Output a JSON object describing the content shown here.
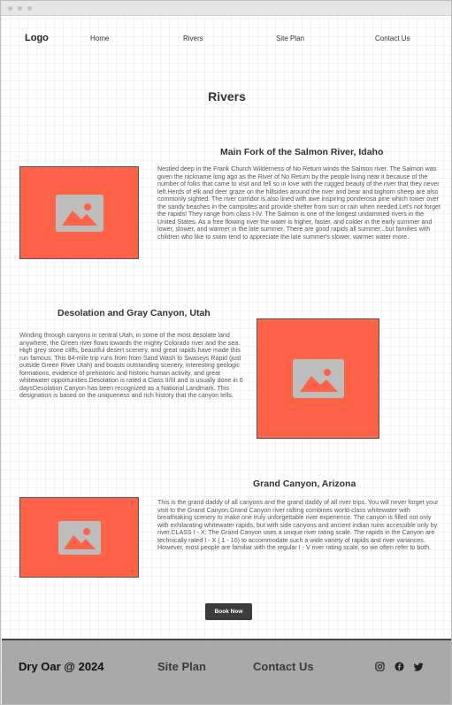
{
  "nav": {
    "logo": "Logo",
    "links": [
      "Home",
      "Rivers",
      "Site Plan",
      "Contact Us"
    ]
  },
  "page": {
    "title": "Rivers"
  },
  "sections": [
    {
      "title": "Main Fork of the Salmon River, Idaho",
      "text": "Nestled deep in the Frank Church Wilderness of No Return winds the Salmon river. The Salmon was given the nickname long ago as the River of No Return by the people living near it because of the number of folks that came to visit and fell so in love with the rugged beauty of the river that they never left.Herds of elk and deer graze on the hillsides around the river and bear and bighorn sheep are also commonly sighted. The river corridor is also lined with awe inspiring ponderosa pine which tower over the sandy beaches in the campsites and provide shelter from sun or rain when needed.Let's not forget the rapids! They range from class I-IV. The Salmon is one of the longest undammed rivers in the United States. As a free flowing river the water is higher, faster, and colder in the early summer and lower, slower, and warmer in the late summer. There are good rapids all summer...but families with children who like to swim tend to appreciate the late summer's slower, warmer water more."
    },
    {
      "title": "Desolation and Gray Canyon, Utah",
      "text": "Winding through canyons in central Utah, in some of the most desolate land anywhere, the Green river flows towards the mighty Colorado river and the sea. High grey stone cliffs, beautiful desert scenery, and great rapids have made this run famous. This 84-mile trip runs from from Sand Wash to Swaseys Rapid (just outside Green River Utah) and boasts outstanding scenery, interesting geologic formations, evidence of prehistoric and historic human activity, and great whitewater opportunities.Desolation is rated a Class II/III and is usually done in 6 daysDesolation Canyon has been recognized as a National Landmark. This designation is based on the uniqueness and rich history that the canyon tells."
    },
    {
      "title": "Grand Canyon, Arizona",
      "text": "This is the grand daddy of all canyons and the grand daddy of all river trips. You will never forget your visit to the Grand Canyon.Grand Canyon river rafting combines world-class whitewater with breathtaking scenery to make one truly unforgettable river experience. The canyon is filled not only with exhilarating whitewater rapids, but with side canyons and ancient indian ruins accessible only by river.CLASS I - X: The Grand Canyon uses a unique river rating scale. The rapids in the Canyon are technically rated I - X ( 1 - 10) to accommodate such a wide variety of rapids and river variances. However, most people are familiar with the regular I - V river rating scale, so we often refer to both."
    }
  ],
  "cta": {
    "label": "Book Now"
  },
  "footer": {
    "brand": "Dry Oar @ 2024",
    "links": [
      "Site Plan",
      "Contact Us"
    ],
    "social_icons": [
      "instagram-icon",
      "facebook-icon",
      "twitter-icon"
    ]
  },
  "colors": {
    "image_placeholder": "#ff6347",
    "footer_bg": "#a9a9a9",
    "button_bg": "#3c3c3c"
  }
}
